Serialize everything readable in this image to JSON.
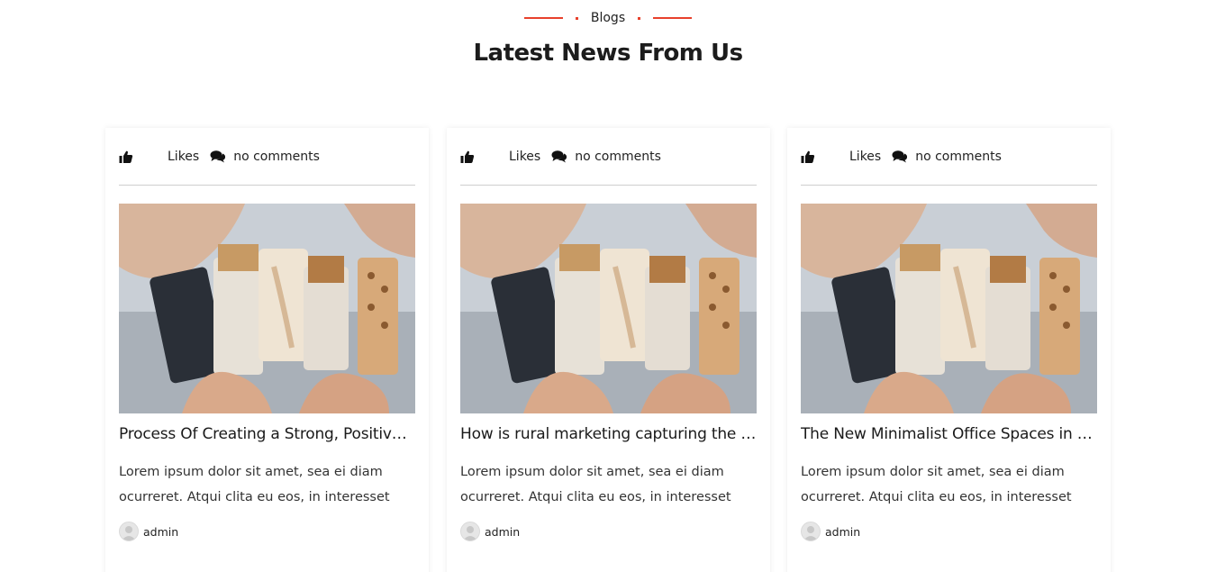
{
  "section": {
    "label": "Blogs",
    "title": "Latest News From Us"
  },
  "colors": {
    "accent": "#e8412c",
    "text": "#1f1f1f"
  },
  "cards": [
    {
      "likes_label": "Likes",
      "comments_label": "no comments",
      "title": "Process Of Creating a Strong, Positive Brand",
      "excerpt": "Lorem ipsum dolor sit amet, sea ei diam ocurreret. Atqui clita eu eos, in interesset",
      "author": "admin",
      "image_icon": "soap-bars-photo"
    },
    {
      "likes_label": "Likes",
      "comments_label": "no comments",
      "title": "How is rural marketing capturing the market",
      "excerpt": "Lorem ipsum dolor sit amet, sea ei diam ocurreret. Atqui clita eu eos, in interesset",
      "author": "admin",
      "image_icon": "soap-bars-photo"
    },
    {
      "likes_label": "Likes",
      "comments_label": "no comments",
      "title": "The New Minimalist Office Spaces in the City",
      "excerpt": "Lorem ipsum dolor sit amet, sea ei diam ocurreret. Atqui clita eu eos, in interesset",
      "author": "admin",
      "image_icon": "soap-bars-photo"
    }
  ]
}
